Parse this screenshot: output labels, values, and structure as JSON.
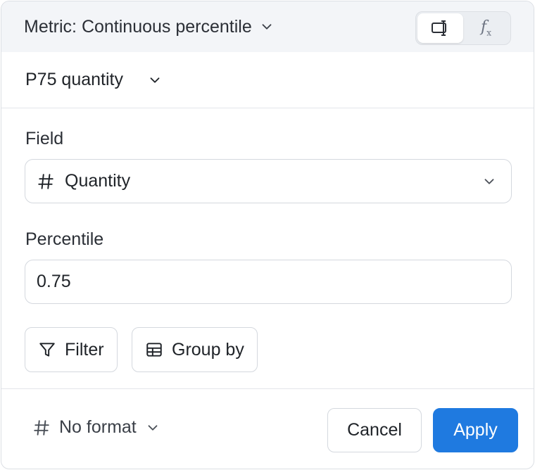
{
  "header": {
    "metric_type_label": "Metric: Continuous percentile",
    "mode_toggle": {
      "active": "editor",
      "options": [
        "editor-icon",
        "formula-icon"
      ]
    }
  },
  "name": {
    "value": "P75 quantity"
  },
  "field": {
    "label": "Field",
    "value": "Quantity",
    "icon": "hash-icon"
  },
  "percentile": {
    "label": "Percentile",
    "value": "0.75"
  },
  "actions": {
    "filter_label": "Filter",
    "group_by_label": "Group by"
  },
  "footer": {
    "format_label": "No format",
    "cancel_label": "Cancel",
    "apply_label": "Apply"
  },
  "colors": {
    "accent": "#1f7ae0",
    "header_bg": "#f3f5f8",
    "border": "#d4d8de"
  }
}
